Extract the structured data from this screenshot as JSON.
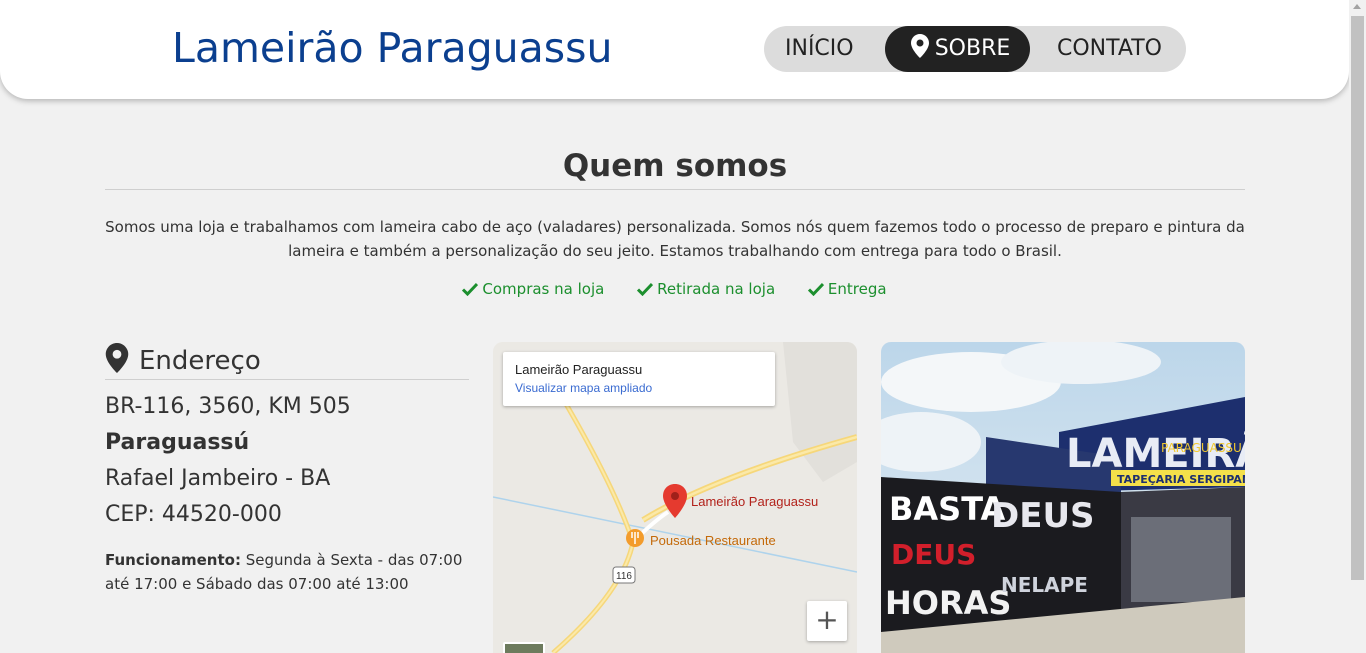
{
  "header": {
    "brand": "Lameirão Paraguassu",
    "nav": {
      "inicio": "INÍCIO",
      "sobre": "SOBRE",
      "contato": "CONTATO"
    }
  },
  "about": {
    "title": "Quem somos",
    "text": "Somos uma loja e trabalhamos com lameira cabo de aço (valadares) personalizada. Somos nós quem fazemos todo o processo de preparo e pintura da lameira e também a personalização do seu jeito. Estamos trabalhando com entrega para todo o Brasil.",
    "features": [
      "Compras na loja",
      "Retirada na loja",
      "Entrega"
    ]
  },
  "address": {
    "heading": "Endereço",
    "street": "BR-116, 3560, KM 505",
    "district": "Paraguassú",
    "city": "Rafael Jambeiro - BA",
    "cep": "CEP: 44520-000",
    "hours_label": "Funcionamento:",
    "hours_text": " Segunda à Sexta - das 07:00 até 17:00 e Sábado das 07:00 até 13:00"
  },
  "map": {
    "card_title": "Lameirão Paraguassu",
    "card_link": "Visualizar mapa ampliado",
    "pin_label": "Lameirão Paraguassu",
    "restaurant_label": "Pousada Restaurante",
    "road_badge": "116",
    "zoom_in": "+"
  },
  "photo": {
    "sign_main": "LAMEIRÃO",
    "sign_sub": "PARAGUASSU",
    "sign_shop": "TAPEÇARIA SERGIPANA",
    "wall_texts": [
      "BASTA",
      "DEUS",
      "DEUS",
      "HORAS",
      "NELAPE"
    ]
  },
  "colors": {
    "brand_blue": "#0b3f8f",
    "feature_green": "#1c8f2e",
    "nav_active_bg": "#222222",
    "page_bg": "#f1f1f1"
  }
}
